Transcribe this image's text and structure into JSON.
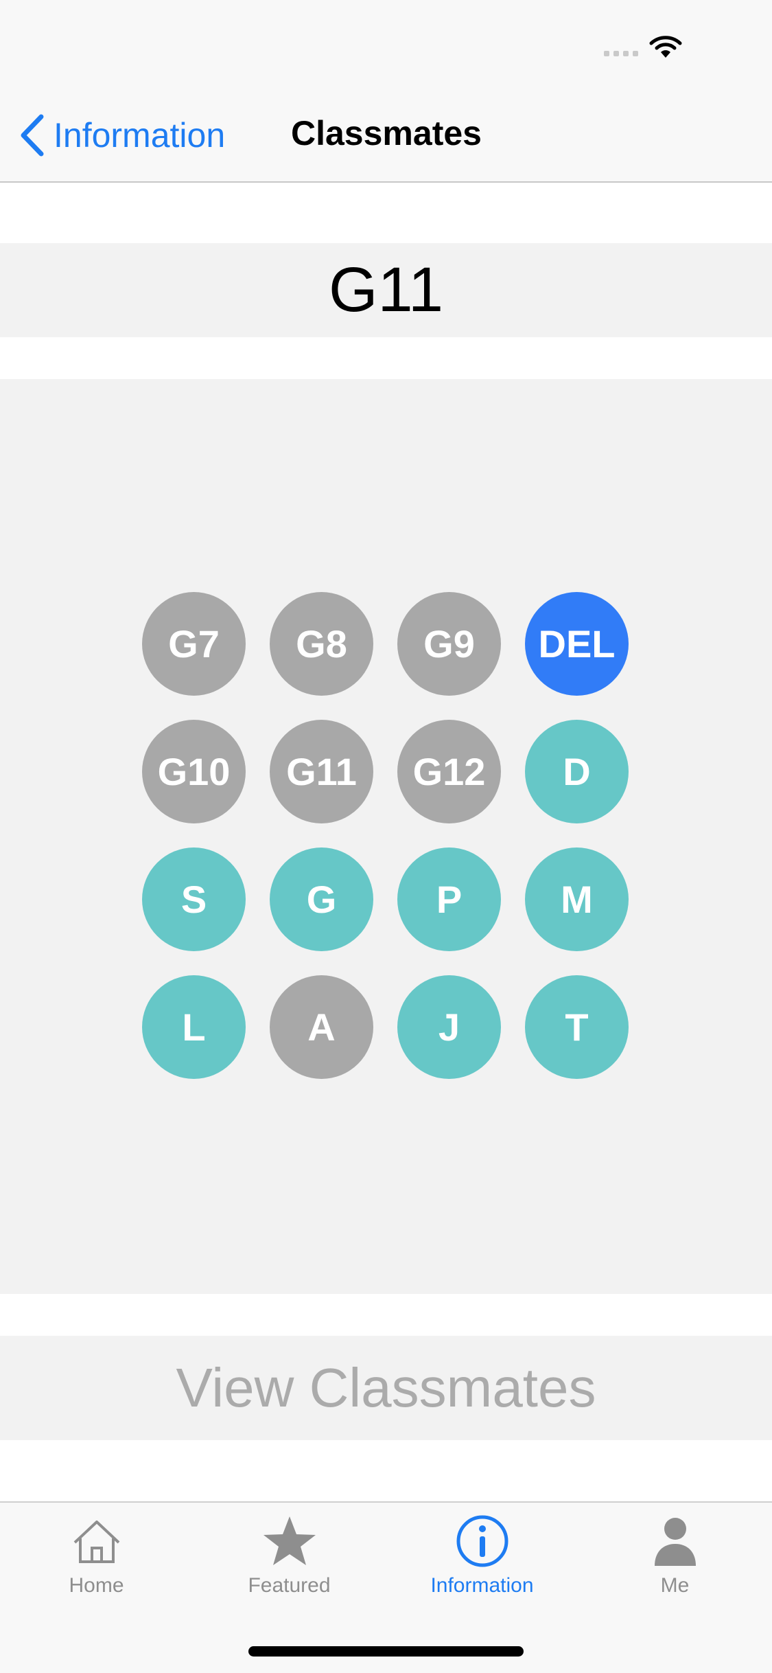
{
  "nav": {
    "back_label": "Information",
    "title": "Classmates"
  },
  "selected": {
    "value": "G11"
  },
  "keypad": {
    "colors": {
      "grade": "#a8a8a8",
      "letter": "#66c7c7",
      "delete": "#317cf7"
    },
    "keys": [
      {
        "label": "G7",
        "kind": "grade"
      },
      {
        "label": "G8",
        "kind": "grade"
      },
      {
        "label": "G9",
        "kind": "grade"
      },
      {
        "label": "DEL",
        "kind": "delete"
      },
      {
        "label": "G10",
        "kind": "grade"
      },
      {
        "label": "G11",
        "kind": "grade"
      },
      {
        "label": "G12",
        "kind": "grade"
      },
      {
        "label": "D",
        "kind": "letter"
      },
      {
        "label": "S",
        "kind": "letter"
      },
      {
        "label": "G",
        "kind": "letter"
      },
      {
        "label": "P",
        "kind": "letter"
      },
      {
        "label": "M",
        "kind": "letter"
      },
      {
        "label": "L",
        "kind": "letter"
      },
      {
        "label": "A",
        "kind": "grade"
      },
      {
        "label": "J",
        "kind": "letter"
      },
      {
        "label": "T",
        "kind": "letter"
      }
    ]
  },
  "view_button": {
    "label": "View Classmates"
  },
  "tabs": [
    {
      "label": "Home",
      "icon": "house-icon",
      "active": false
    },
    {
      "label": "Featured",
      "icon": "star-icon",
      "active": false
    },
    {
      "label": "Information",
      "icon": "info-circle-icon",
      "active": true
    },
    {
      "label": "Me",
      "icon": "person-icon",
      "active": false
    }
  ],
  "colors": {
    "accent": "#1e7cf2",
    "inactive": "#8e8e8e"
  }
}
